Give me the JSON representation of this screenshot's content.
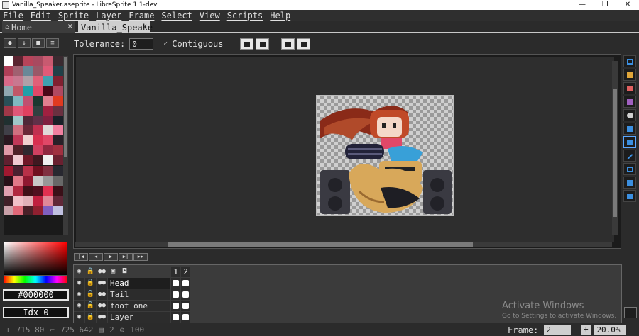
{
  "window": {
    "title": "Vanilla_Speaker.aseprite - LibreSprite 1.1-dev",
    "controls": [
      "—",
      "❐",
      "✕"
    ]
  },
  "menu": [
    "File",
    "Edit",
    "Sprite",
    "Layer",
    "Frame",
    "Select",
    "View",
    "Scripts",
    "Help"
  ],
  "tabs": {
    "home": "Home",
    "document": "Vanilla_Speake",
    "close": "✕"
  },
  "context_bar": {
    "tolerance_label": "Tolerance:",
    "tolerance_value": "0",
    "contiguous_label": "Contiguous",
    "contiguous_checked": "✓"
  },
  "palette": {
    "colors": [
      "#ffffff",
      "#5a2430",
      "#b8445a",
      "#a84a60",
      "#c85a70",
      "#3a2a30",
      "#b04058",
      "#a06070",
      "#6a8898",
      "#9a5868",
      "#e05a78",
      "#204048",
      "#d86a88",
      "#c87890",
      "#b0a0a8",
      "#e06078",
      "#40a0b0",
      "#802030",
      "#90a8b0",
      "#c05868",
      "#20a0a8",
      "#e04868",
      "#4a0818",
      "#b04860",
      "#2a5058",
      "#80b8c0",
      "#c05070",
      "#1a3830",
      "#e08090",
      "#e03a20",
      "#a03848",
      "#e05878",
      "#e04060",
      "#304040",
      "#a02040",
      "#6a3040",
      "#203030",
      "#a0c8c8",
      "#502838",
      "#603048",
      "#802040",
      "#1a2028",
      "#404048",
      "#d07080",
      "#6a2838",
      "#c03050",
      "#e0d8d8",
      "#f080a0",
      "#2a1820",
      "#c03858",
      "#f0d0d0",
      "#d83050",
      "#e04868",
      "#282028",
      "#e09aa8",
      "#502028",
      "#302830",
      "#d04060",
      "#902840",
      "#a03040",
      "#602030",
      "#f0c8d0",
      "#701828",
      "#401820",
      "#f0f0f0",
      "#6a2030",
      "#a01830",
      "#4a2030",
      "#b83048",
      "#701020",
      "#803040",
      "#282830",
      "#281018",
      "#e07888",
      "#901830",
      "#c8c8c8",
      "#989898",
      "#686868",
      "#e0a0b0",
      "#b02840",
      "#401018",
      "#501020",
      "#e03050",
      "#3a1018",
      "#402028",
      "#f0c0c8",
      "#e0b0b8",
      "#c02040",
      "#e08898",
      "#602838",
      "#c8a0a8",
      "#e06878",
      "#4a2028",
      "#902030",
      "#8060c0",
      "#c0c0e0"
    ]
  },
  "picker": {
    "hex": "#000000",
    "index": "Idx-0"
  },
  "layers": {
    "frame_headers": [
      "1",
      "2"
    ],
    "rows": [
      {
        "name": "Head",
        "selected": true
      },
      {
        "name": "Tail",
        "selected": false
      },
      {
        "name": "foot one",
        "selected": false
      },
      {
        "name": "Layer",
        "selected": false
      }
    ]
  },
  "watermark": {
    "line1": "Activate Windows",
    "line2": "Go to Settings to activate Windows."
  },
  "status": {
    "cursor": "715 80",
    "size": "725 642",
    "frames": "2",
    "zoom_pct": "100"
  },
  "frame_bar": {
    "label": "Frame:",
    "frame": "2",
    "plus": "+",
    "zoom": "20.0%"
  }
}
